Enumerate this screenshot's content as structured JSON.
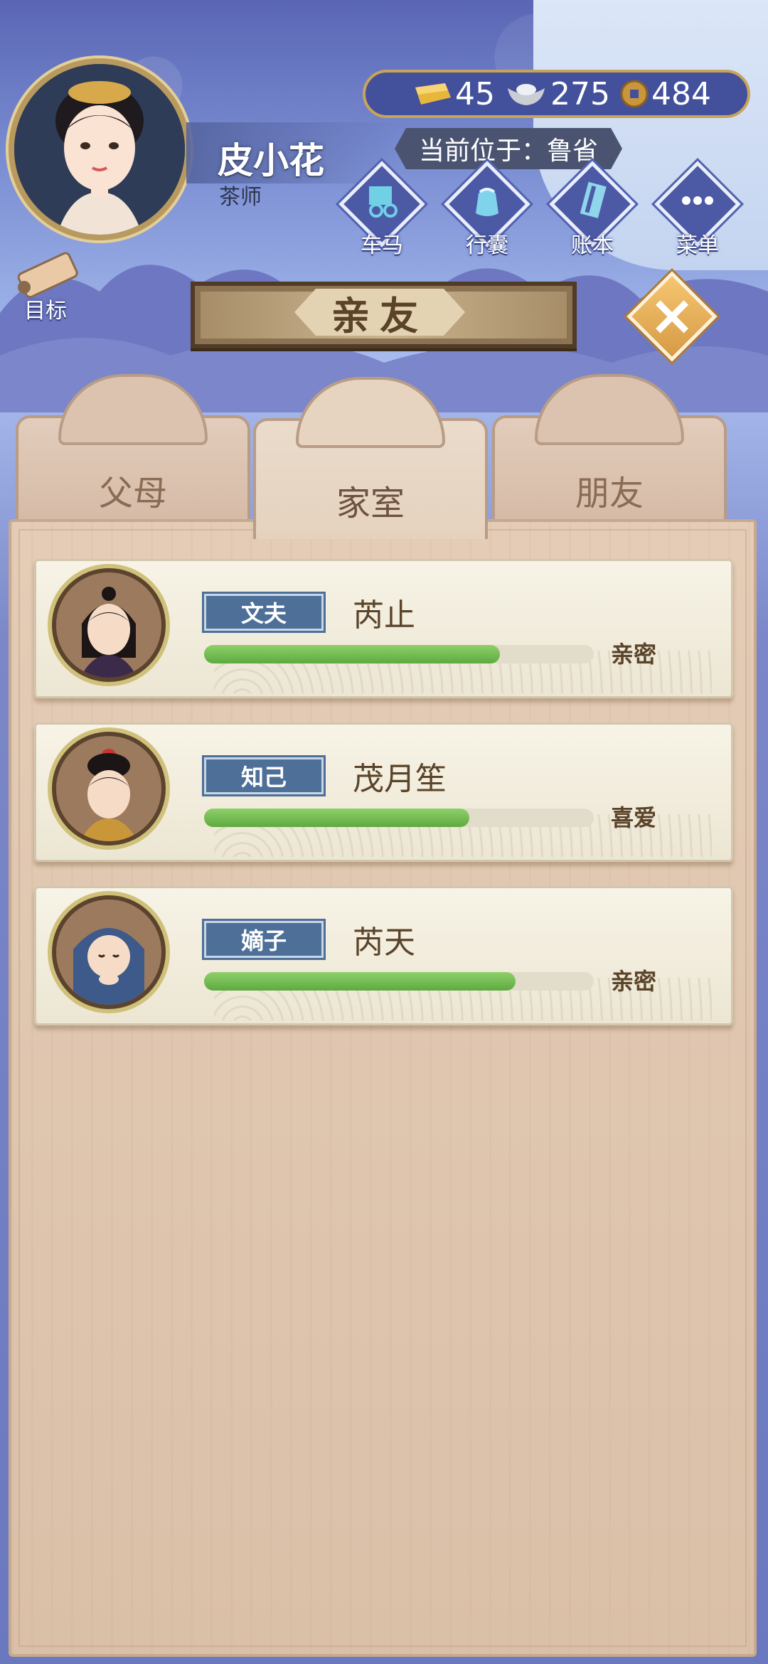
{
  "player": {
    "name": "皮小花",
    "title": "茶师",
    "location_label": "当前位于：鲁省"
  },
  "currency": {
    "gold": "45",
    "silver": "275",
    "coin": "484"
  },
  "menu": {
    "carriage": "车马",
    "bag": "行囊",
    "ledger": "账本",
    "menu": "菜单",
    "target": "目标"
  },
  "panel_title": "亲友",
  "tabs": [
    {
      "label": "父母",
      "active": false
    },
    {
      "label": "家室",
      "active": true
    },
    {
      "label": "朋友",
      "active": false
    }
  ],
  "relations": [
    {
      "role": "文夫",
      "name": "芮止",
      "level": "亲密",
      "affinity": 0.76
    },
    {
      "role": "知己",
      "name": "茂月笙",
      "level": "喜爱",
      "affinity": 0.68
    },
    {
      "role": "嫡子",
      "name": "芮天",
      "level": "亲密",
      "affinity": 0.8
    }
  ],
  "colors": {
    "accent_blue": "#4d6f98",
    "affinity_green": "#6bb84b",
    "gold_border": "#c8a45a",
    "brown_text": "#5a4329"
  }
}
